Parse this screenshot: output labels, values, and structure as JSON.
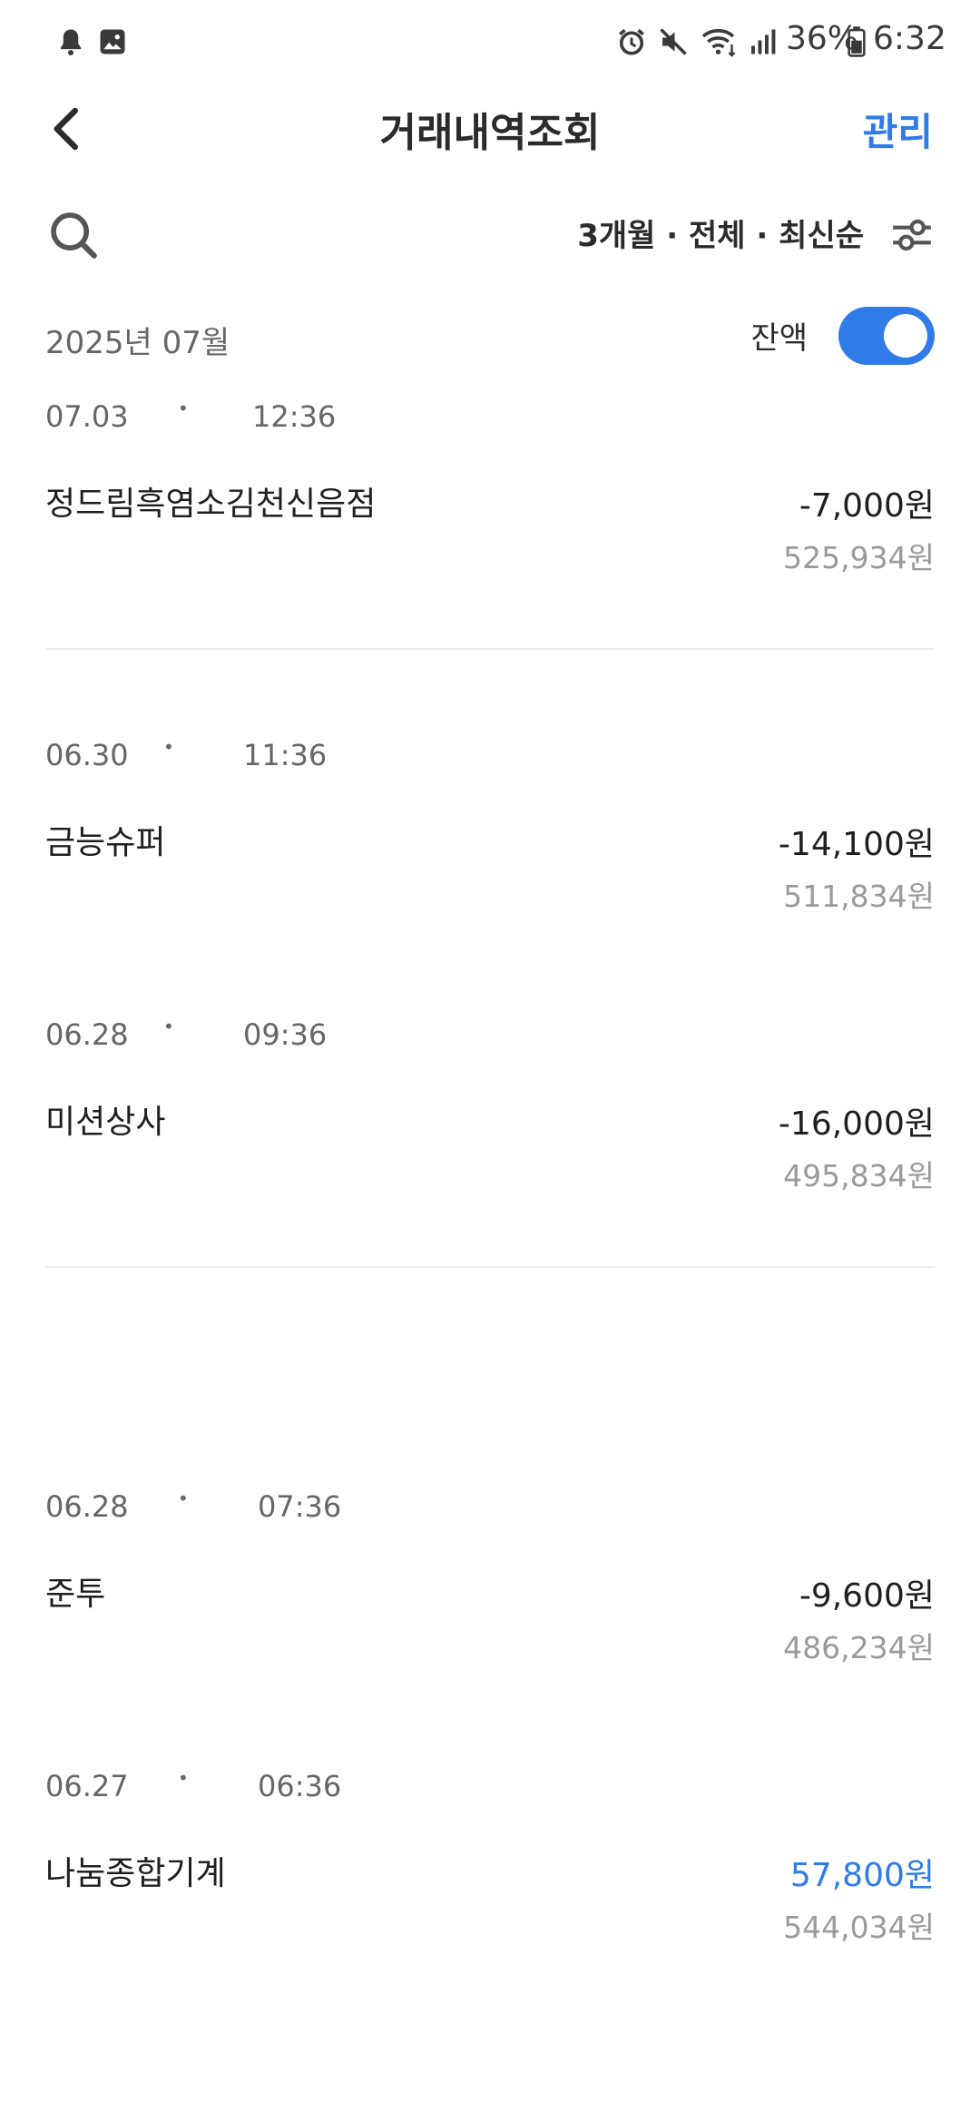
{
  "status_bar": {
    "battery": "36%",
    "time": "6:32"
  },
  "header": {
    "title": "거래내역조회",
    "manage_label": "관리"
  },
  "filter": {
    "label": "3개월 · 전체 · 최신순"
  },
  "month": {
    "label": "2025년 07월"
  },
  "balance_toggle": {
    "label": "잔액",
    "on": true
  },
  "colors": {
    "accent": "#2f7be8",
    "income": "#2f7be8"
  },
  "transactions": [
    {
      "date": "07.03",
      "time": "12:36",
      "merchant": "정드림흑염소김천신음점",
      "amount": "-7,000원",
      "balance": "525,934원",
      "type": "expense"
    },
    {
      "date": "06.30",
      "time": "11:36",
      "merchant": "금능슈퍼",
      "amount": "-14,100원",
      "balance": "511,834원",
      "type": "expense"
    },
    {
      "date": "06.28",
      "time": "09:36",
      "merchant": "미션상사",
      "amount": "-16,000원",
      "balance": "495,834원",
      "type": "expense"
    },
    {
      "date": "06.28",
      "time": "07:36",
      "merchant": "준투",
      "amount": "-9,600원",
      "balance": "486,234원",
      "type": "expense"
    },
    {
      "date": "06.27",
      "time": "06:36",
      "merchant": "나눔종합기계",
      "amount": "57,800원",
      "balance": "544,034원",
      "type": "income"
    }
  ]
}
